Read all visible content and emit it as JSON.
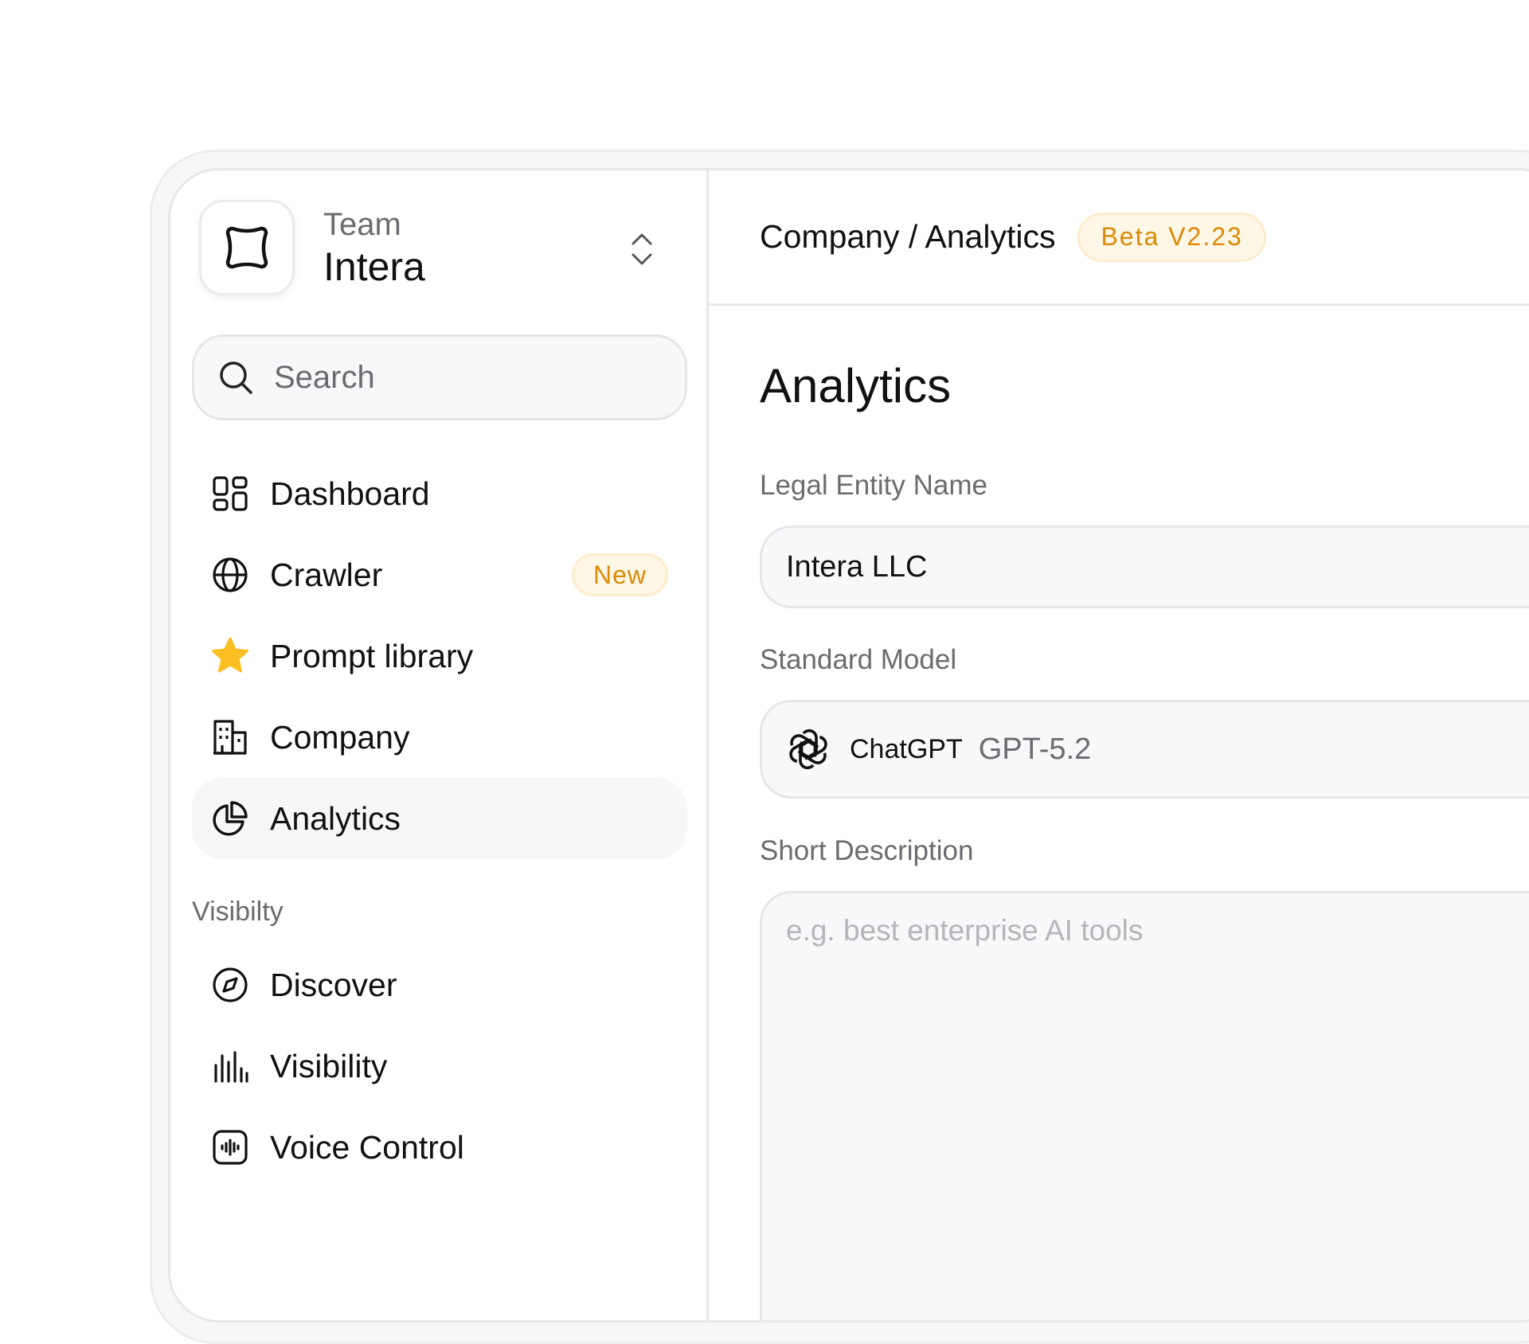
{
  "team": {
    "label": "Team",
    "name": "Intera"
  },
  "search": {
    "placeholder": "Search"
  },
  "nav": {
    "items": [
      {
        "label": "Dashboard",
        "icon": "grid-icon"
      },
      {
        "label": "Crawler",
        "icon": "globe-icon",
        "badge": "New"
      },
      {
        "label": "Prompt library",
        "icon": "star-icon"
      },
      {
        "label": "Company",
        "icon": "building-icon"
      },
      {
        "label": "Analytics",
        "icon": "pie-chart-icon",
        "active": true
      }
    ]
  },
  "visibility_section": {
    "label": "Visibilty",
    "items": [
      {
        "label": "Discover",
        "icon": "compass-icon"
      },
      {
        "label": "Visibility",
        "icon": "bar-lines-icon"
      },
      {
        "label": "Voice Control",
        "icon": "waveform-icon"
      }
    ]
  },
  "header": {
    "breadcrumb": "Company / Analytics",
    "badge": "Beta V2.23"
  },
  "main": {
    "title": "Analytics",
    "legal_entity": {
      "label": "Legal Entity Name",
      "value": "Intera LLC"
    },
    "standard_model": {
      "label": "Standard Model",
      "provider": "ChatGPT",
      "version": "GPT-5.2"
    },
    "short_description": {
      "label": "Short Description",
      "placeholder": "e.g. best enterprise AI tools",
      "value": ""
    }
  },
  "colors": {
    "accent_orange": "#d98a06",
    "badge_bg": "#fff7e6",
    "star_yellow": "#fbbf24",
    "muted_text": "#6b6b70"
  }
}
